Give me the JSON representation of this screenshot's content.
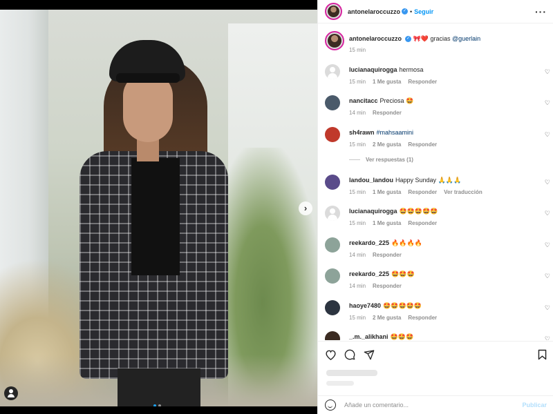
{
  "post": {
    "author": "antonelaroccuzzo",
    "follow_label": "Seguir",
    "more_icon": "more-horizontal-icon",
    "separator": "•"
  },
  "caption": {
    "author": "antonelaroccuzzo",
    "text": "gracias",
    "emojis": "🎀❤️",
    "mention": "@guerlain",
    "time": "15 min"
  },
  "comments": [
    {
      "user": "lucianaquirogga",
      "text": "hermosa",
      "time": "15 min",
      "likes": "1 Me gusta",
      "reply": "Responder",
      "extra": ""
    },
    {
      "user": "nancitacc",
      "text": "Preciosa 🤩",
      "time": "14 min",
      "likes": "",
      "reply": "Responder",
      "extra": ""
    },
    {
      "user": "sh4rawn",
      "text": "#mahsaamini",
      "time": "15 min",
      "likes": "2 Me gusta",
      "reply": "Responder",
      "extra": ""
    },
    {
      "user": "landou_landou",
      "text": "Happy Sunday 🙏🙏🙏",
      "time": "15 min",
      "likes": "1 Me gusta",
      "reply": "Responder",
      "extra": "Ver traducción"
    },
    {
      "user": "lucianaquirogga",
      "text": "🤩🤩🤩🤩🤩",
      "time": "15 min",
      "likes": "1 Me gusta",
      "reply": "Responder",
      "extra": ""
    },
    {
      "user": "reekardo_225",
      "text": "🔥🔥🔥🔥",
      "time": "14 min",
      "likes": "",
      "reply": "Responder",
      "extra": ""
    },
    {
      "user": "reekardo_225",
      "text": "🤩🤩🤩",
      "time": "14 min",
      "likes": "",
      "reply": "Responder",
      "extra": ""
    },
    {
      "user": "haoye7480",
      "text": "🤩🤩🤩🤩🤩",
      "time": "15 min",
      "likes": "2 Me gusta",
      "reply": "Responder",
      "extra": ""
    },
    {
      "user": "_.m._alikhani",
      "text": "🤩🤩🤩",
      "time": "",
      "likes": "",
      "reply": "",
      "extra": ""
    }
  ],
  "view_replies": "Ver respuestas (1)",
  "actions": {
    "like_icon": "heart-icon",
    "comment_icon": "comment-icon",
    "share_icon": "send-icon",
    "save_icon": "bookmark-icon"
  },
  "composer": {
    "placeholder": "Añade un comentario...",
    "publish_label": "Publicar",
    "emoji_icon": "emoji-icon"
  },
  "colors": {
    "accent": "#0095f6",
    "verified": "#3897f0",
    "story_ring": "#d6249f",
    "publish_disabled": "#b2dffc"
  }
}
